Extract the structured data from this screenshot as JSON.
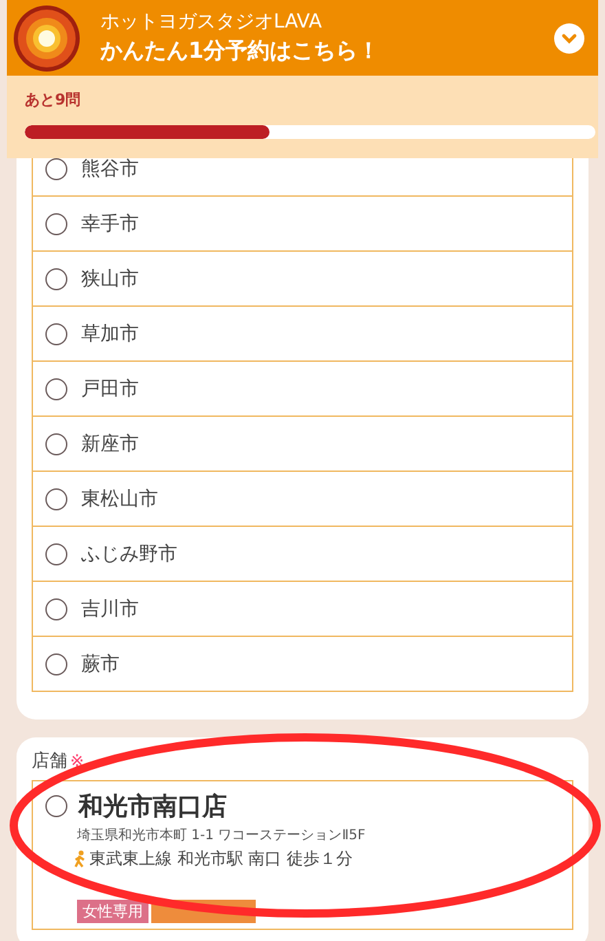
{
  "header": {
    "brand": "ホットヨガスタジオLAVA",
    "title": "かんたん1分予約はこちら！",
    "expanded": false
  },
  "progress": {
    "label": "あと9問",
    "level": 0.43
  },
  "cities": [
    {
      "name": "熊谷市",
      "selected": false
    },
    {
      "name": "幸手市",
      "selected": false
    },
    {
      "name": "狭山市",
      "selected": false
    },
    {
      "name": "草加市",
      "selected": false
    },
    {
      "name": "戸田市",
      "selected": false
    },
    {
      "name": "新座市",
      "selected": false
    },
    {
      "name": "東松山市",
      "selected": false
    },
    {
      "name": "ふじみ野市",
      "selected": false
    },
    {
      "name": "吉川市",
      "selected": false
    },
    {
      "name": "蕨市",
      "selected": false
    }
  ],
  "store_section": {
    "label": "店舗",
    "required": "※",
    "stores": [
      {
        "name": "和光市南口店",
        "selected": false,
        "address": "埼玉県和光市本町 1-1 ワコーステーションⅡ5F",
        "access": "東武東上線 和光市駅 南口 徒歩１分",
        "tags": [
          {
            "label": "女性専用",
            "color": "#dc7088"
          },
          {
            "kind": "covered",
            "color": "#ee8c3c"
          }
        ]
      }
    ]
  },
  "annotation": {
    "kind": "ellipse",
    "color": "#ff2a2a"
  }
}
